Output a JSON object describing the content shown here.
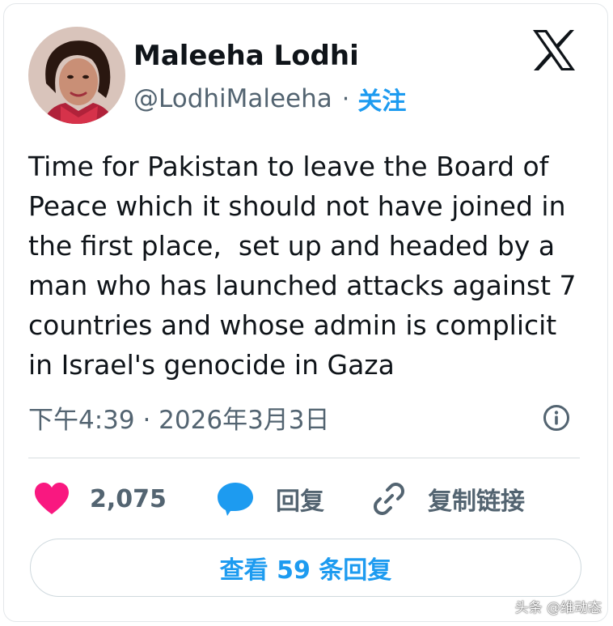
{
  "author": {
    "display_name": "Maleeha Lodhi",
    "handle": "@LodhiMaleeha",
    "separator": "·",
    "follow_label": "关注"
  },
  "tweet": {
    "text": "Time for Pakistan to leave the Board of\nPeace which it should not have joined in\nthe first place,  set up and headed by a\nman who has launched attacks against 7\ncountries and whose admin is complicit\nin Israel's genocide in Gaza",
    "timestamp": "下午4:39 · 2026年3月3日"
  },
  "actions": {
    "like_count": "2,075",
    "reply_label": "回复",
    "copy_link_label": "复制链接"
  },
  "replies_button": {
    "label": "查看 59 条回复"
  },
  "watermark": {
    "text": "头条 @维动态"
  },
  "icons": {
    "brand": "x-logo-icon",
    "info": "info-icon",
    "like": "heart-icon",
    "reply": "speech-bubble-icon",
    "copy_link": "link-icon"
  },
  "colors": {
    "accent": "#1d9bf0",
    "like": "#f91880",
    "secondary_text": "#536471",
    "primary_text": "#0f1419"
  }
}
